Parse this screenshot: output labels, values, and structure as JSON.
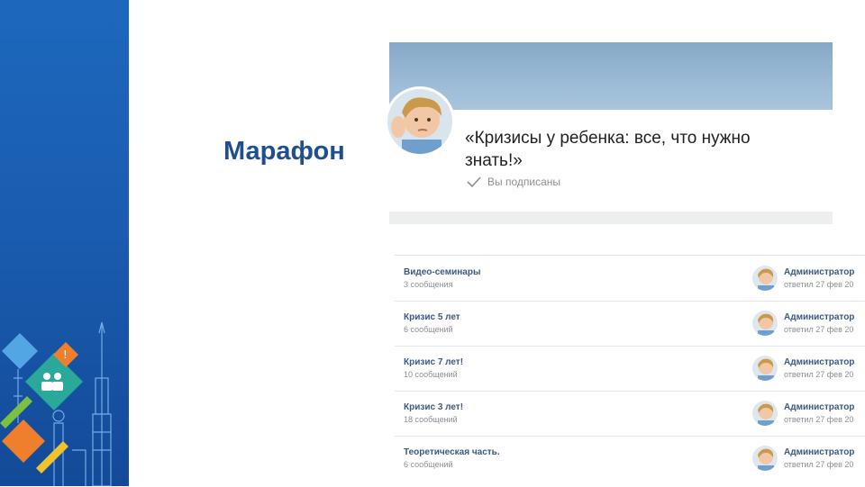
{
  "slide": {
    "title": "Марафон"
  },
  "group": {
    "name": "«Кризисы у ребенка: все, что нужно знать!»",
    "subscription_status": "Вы подписаны"
  },
  "topics": [
    {
      "title": "Видео-семинары",
      "count": "3 сообщения",
      "author": "Администратор",
      "reply": "ответил 27 фев 20"
    },
    {
      "title": "Кризис 5 лет",
      "count": "6 сообщений",
      "author": "Администратор",
      "reply": "ответил 27 фев 20"
    },
    {
      "title": "Кризис 7 лет!",
      "count": "10 сообщений",
      "author": "Администратор",
      "reply": "ответил 27 фев 20"
    },
    {
      "title": "Кризис 3 лет!",
      "count": "18 сообщений",
      "author": "Администратор",
      "reply": "ответил 27 фев 20"
    },
    {
      "title": "Теоретическая часть.",
      "count": "6 сообщений",
      "author": "Администратор",
      "reply": "ответил 27 фев 20"
    }
  ],
  "colors": {
    "accent_blue": "#1d68bd",
    "link_blue": "#3b5a80",
    "title_blue": "#1f4f8f"
  }
}
